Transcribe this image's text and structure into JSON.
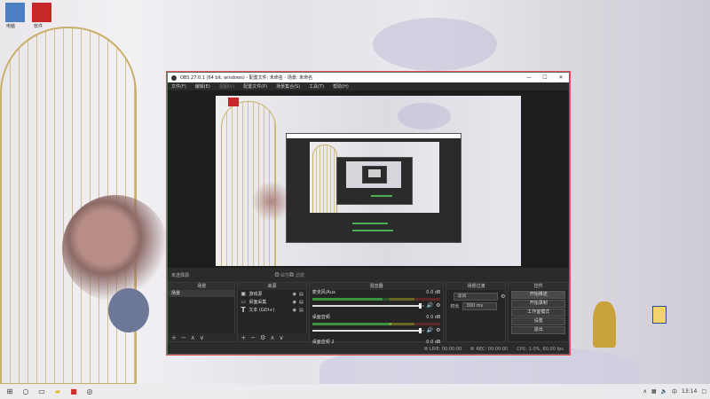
{
  "desktop": {
    "icons": [
      {
        "label": "电脑",
        "icon": "pc-icon",
        "color": "#4a7fc1"
      },
      {
        "label": "软件",
        "icon": "red-app-icon",
        "color": "#c62828"
      }
    ],
    "right_icon": "document-icon"
  },
  "window": {
    "title": "OBS 27.0.1 (64 bit, windows) - 配置文件: 未命名 - 场景: 未命名",
    "controls": {
      "minimize": "—",
      "maximize": "☐",
      "close": "✕"
    }
  },
  "menu": [
    "文件(F)",
    "编辑(E)",
    "视图(V)",
    "配置文件(P)",
    "场景集合(S)",
    "工具(T)",
    "帮助(H)"
  ],
  "source_toolbar": {
    "selected_label": "未选择源",
    "properties_label": "属性",
    "filters_label": "滤镜"
  },
  "docks": {
    "scenes": {
      "title": "场景",
      "items": [
        "场景"
      ],
      "footer": [
        "+",
        "−",
        "∧",
        "∨"
      ]
    },
    "sources": {
      "title": "来源",
      "items": [
        {
          "icon": "camera-icon",
          "glyph": "▣",
          "label": "游戏源"
        },
        {
          "icon": "monitor-icon",
          "glyph": "▭",
          "label": "桌面采集"
        },
        {
          "icon": "text-icon",
          "glyph": "T",
          "label": "文本 (GDI+)"
        }
      ],
      "footer": [
        "+",
        "−",
        "⚙",
        "∧",
        "∨"
      ]
    },
    "mixer": {
      "title": "混音器",
      "channels": [
        {
          "name": "麦克风/Aux",
          "db": "0.0 dB",
          "level": 0.55,
          "volume": 0.97
        },
        {
          "name": "桌面音频",
          "db": "0.0 dB",
          "level": 0.62,
          "volume": 0.97
        },
        {
          "name": "桌面音频 2",
          "db": "0.0 dB",
          "level": 0.0,
          "volume": 0.97
        }
      ]
    },
    "transitions": {
      "title": "场景过渡",
      "type": "淡出",
      "duration_label": "时长",
      "duration": "300 ms"
    },
    "controls": {
      "title": "控件",
      "buttons": [
        "开始推流",
        "开始录制",
        "工作室模式",
        "设置",
        "退出"
      ]
    }
  },
  "status": {
    "live": "LIVE: 00:00:00",
    "rec": "REC: 00:00:00",
    "cpu": "CPU: 1.0%, 60.00 fps"
  },
  "taskbar": {
    "time": "13:14",
    "lang": "中"
  }
}
